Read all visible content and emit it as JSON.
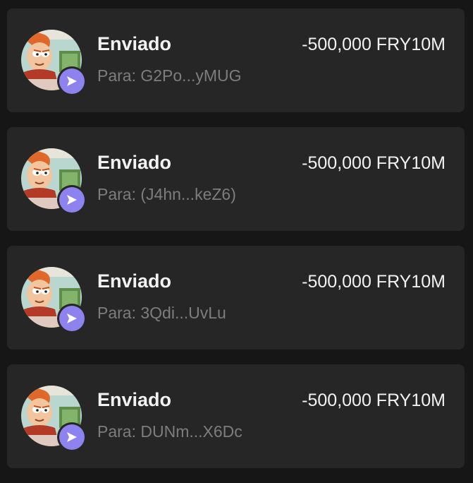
{
  "transactions": [
    {
      "title": "Enviado",
      "amount": "-500,000 FRY10M",
      "recipient": "Para: G2Po...yMUG",
      "token_icon": "fry-meme-avatar",
      "status_icon": "send-arrow-icon"
    },
    {
      "title": "Enviado",
      "amount": "-500,000 FRY10M",
      "recipient": "Para: (J4hn...keZ6)",
      "token_icon": "fry-meme-avatar",
      "status_icon": "send-arrow-icon"
    },
    {
      "title": "Enviado",
      "amount": "-500,000 FRY10M",
      "recipient": "Para: 3Qdi...UvLu",
      "token_icon": "fry-meme-avatar",
      "status_icon": "send-arrow-icon"
    },
    {
      "title": "Enviado",
      "amount": "-500,000 FRY10M",
      "recipient": "Para: DUNm...X6Dc",
      "token_icon": "fry-meme-avatar",
      "status_icon": "send-arrow-icon"
    }
  ],
  "colors": {
    "background": "#161616",
    "card": "#262626",
    "primary_text": "#f2f2f2",
    "secondary_text": "#7d7d7d",
    "badge": "#8e82ee"
  }
}
